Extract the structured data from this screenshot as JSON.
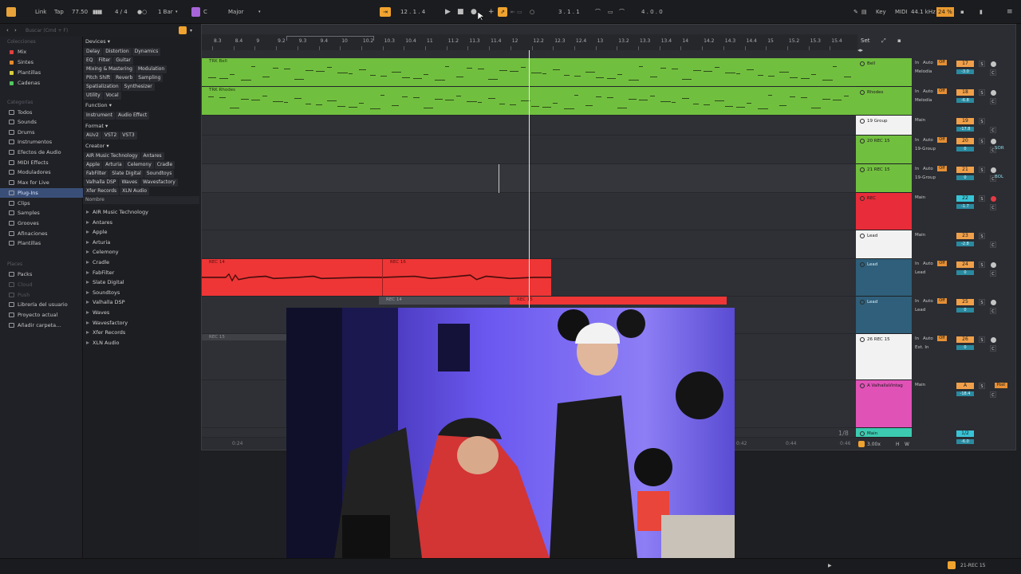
{
  "topbar": {
    "link": "Link",
    "tap": "Tap",
    "tempo": "77.50",
    "signature": "4 / 4",
    "quantize": "1 Bar",
    "key": "C",
    "scale": "Major",
    "position": "12 .  1 .  4",
    "loop_start": "3 .  1 .  1",
    "loop_length": "4 .  0 .  0",
    "key_label": "Key",
    "midi_label": "MIDI",
    "sample_rate": "44.1 kHz",
    "cpu": "24 %"
  },
  "browser": {
    "search_placeholder": "Buscar (Cmd + F)",
    "collections_title": "Colecciones",
    "collections": [
      {
        "label": "Mix",
        "color": "#e2403f"
      },
      {
        "label": "Sintes",
        "color": "#e58a2b"
      },
      {
        "label": "Plantillas",
        "color": "#d6cf3d"
      },
      {
        "label": "Cadenas",
        "color": "#52c75f"
      }
    ],
    "categories_title": "Categorías",
    "categories": [
      "Todos",
      "Sounds",
      "Drums",
      "Instrumentos",
      "Efectos de Audio",
      "MIDI Effects",
      "Moduladores",
      "Max for Live",
      "Plug-Ins",
      "Clips",
      "Samples",
      "Grooves",
      "Afinaciones",
      "Plantillas"
    ],
    "selected_category": "Plug-Ins",
    "places_title": "Places",
    "places": [
      "Packs",
      "Cloud",
      "Push",
      "Librería del usuario",
      "Proyecto actual",
      "Añadir carpeta..."
    ],
    "devices_label": "Devices",
    "device_tags": [
      [
        "Delay",
        "Distortion",
        "Dynamics"
      ],
      [
        "EQ",
        "Filter",
        "Guitar"
      ],
      [
        "Mixing & Mastering",
        "Modulation"
      ],
      [
        "Pitch Shift",
        "Reverb",
        "Sampling"
      ],
      [
        "Spatialization",
        "Synthesizer"
      ],
      [
        "Utility",
        "Vocal"
      ]
    ],
    "function_label": "Function",
    "function_tags": [
      "Instrument",
      "Audio Effect"
    ],
    "format_label": "Format",
    "format_tags": [
      "AUv2",
      "VST2",
      "VST3"
    ],
    "creator_label": "Creator",
    "creator_tags": [
      [
        "AIR Music Technology",
        "Antares"
      ],
      [
        "Apple",
        "Arturia",
        "Celemony",
        "Cradle"
      ],
      [
        "FabFilter",
        "Slate Digital",
        "Soundtoys"
      ],
      [
        "Valhalla DSP",
        "Waves",
        "Wavesfactory"
      ],
      [
        "Xfer Records",
        "XLN Audio"
      ]
    ],
    "list_header": "Nombre",
    "plugins": [
      "AIR Music Technology",
      "Antares",
      "Apple",
      "Arturia",
      "Celemony",
      "Cradle",
      "FabFilter",
      "Slate Digital",
      "Soundtoys",
      "Valhalla DSP",
      "Waves",
      "Wavesfactory",
      "Xfer Records",
      "XLN Audio"
    ]
  },
  "ruler": {
    "ticks": [
      "8.3",
      "8.4",
      "9",
      "9.2",
      "9.3",
      "9.4",
      "10",
      "10.2",
      "10.3",
      "10.4",
      "11",
      "11.2",
      "11.3",
      "11.4",
      "12",
      "12.2",
      "12.3",
      "12.4",
      "13",
      "13.2",
      "13.3",
      "13.4",
      "14",
      "14.2",
      "14.3",
      "14.4",
      "15",
      "15.2",
      "15.3",
      "15.4"
    ],
    "set_label": "Set",
    "bottom_time_left": "0:24",
    "bottom_time_mid": "0:42",
    "bottom_time_right": "0:44",
    "bottom_time_far": "0:46"
  },
  "clips": {
    "bell": "TRK Bell",
    "rhodes": "TRK Rhodes",
    "rec_a": "REC 14",
    "rec_b": "REC 16",
    "rec_c": "REC 14",
    "rec_d": "REC 15",
    "rec_e": "REC 15"
  },
  "tracks": [
    {
      "name": "Bell",
      "color": "#71bf3f",
      "num": "17",
      "input": "Melodía",
      "mode": "In",
      "vol": "-3.0"
    },
    {
      "name": "Rhodes",
      "color": "#71bf3f",
      "num": "18",
      "input": "Melodía",
      "mode": "In",
      "vol": "-6.8"
    },
    {
      "name": "19 Group",
      "color": "#f2f2f2",
      "num": "19",
      "input": "Main",
      "mode": "",
      "vol": "-17.8"
    },
    {
      "name": "20 REC 15",
      "color": "#71bf3f",
      "num": "20",
      "input": "19-Group",
      "mode": "In",
      "vol": "0"
    },
    {
      "name": "21 REC 15",
      "color": "#71bf3f",
      "num": "21",
      "input": "19-Group",
      "mode": "In",
      "vol": "0"
    },
    {
      "name": "REC",
      "color": "#e82c3a",
      "num": "22",
      "input": "Main",
      "mode": "",
      "vol": "-1.7"
    },
    {
      "name": "Lead",
      "color": "#f2f2f2",
      "num": "23",
      "input": "Main",
      "mode": "",
      "vol": "-2.8"
    },
    {
      "name": "Lead",
      "color": "#2f5f7a",
      "num": "24",
      "input": "Lead",
      "mode": "In",
      "vol": "0"
    },
    {
      "name": "Lead",
      "color": "#2f5f7a",
      "num": "25",
      "input": "Lead",
      "mode": "In",
      "vol": "0"
    },
    {
      "name": "26 REC 15",
      "color": "#f2f2f2",
      "num": "26",
      "input": "Ext. In",
      "mode": "In",
      "vol": "0"
    },
    {
      "name": "A ValhallaVintag",
      "color": "#e052b6",
      "num": "A",
      "input": "Main",
      "mode": "Post",
      "vol": "-18.4"
    },
    {
      "name": "Main",
      "color": "#3ccab0",
      "num": "1/2",
      "input": "",
      "mode": "",
      "vol": "-6.0"
    }
  ],
  "mixer": {
    "auto": "Auto",
    "off": "Off",
    "s": "S",
    "c": "C",
    "zoom": "3.00x",
    "h": "H",
    "w": "W",
    "fraction": "1/8",
    "sor": "SOR",
    "bol": "BOL"
  },
  "status": {
    "selected_track": "21-REC 15"
  }
}
